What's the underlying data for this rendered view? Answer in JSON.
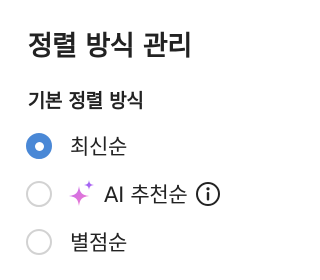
{
  "panel": {
    "title": "정렬 방식 관리",
    "section_title": "기본 정렬 방식",
    "options": [
      {
        "label": "최신순",
        "selected": true
      },
      {
        "label": "AI 추천순",
        "selected": false,
        "icon": "sparkle-icon",
        "info_icon": "info-icon"
      },
      {
        "label": "별점순",
        "selected": false
      }
    ]
  },
  "colors": {
    "accent": "#4a88d6",
    "radio_border": "#d2d2d2",
    "text": "#222222",
    "sparkle_purple": "#a35ff0",
    "sparkle_pink": "#f07ac8"
  }
}
